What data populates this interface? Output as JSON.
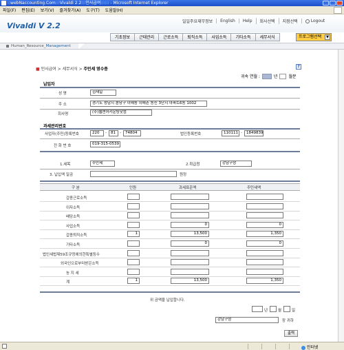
{
  "window": {
    "title": "::webNaccounting.Com:::Vivaldi 2.2:::인사급여:::::: - Microsoft Internet Explorer"
  },
  "menu": {
    "items": [
      "파일(F)",
      "편집(E)",
      "보기(V)",
      "즐겨찾기(A)",
      "도구(T)",
      "도움말(H)"
    ]
  },
  "app": {
    "logo": "Vivaldi  V 2.2",
    "top_links": [
      "일일주요재무정보",
      "English",
      "Help",
      "회사선택",
      "지점선택"
    ],
    "logout": "Logout",
    "nav_tabs": [
      "기초정보",
      "근태관리",
      "근로소득",
      "퇴직소득",
      "사업소득",
      "기타소득",
      "세무서식"
    ],
    "program_select": "프로그램선택",
    "module_label_prefix": "Human_Resource_",
    "module_label_accent": "Management"
  },
  "breadcrumb": {
    "root": "인사급여",
    "sep": ">",
    "mid": "세무서식",
    "current": "주민세 영수증"
  },
  "year_line": {
    "label": "귀속 연월 :",
    "year_unit": "년",
    "month_unit": "월분"
  },
  "payer": {
    "title": "납입자",
    "name_label": "성 명",
    "name_value": "김재일",
    "address_label": "주 소",
    "address_value": "경기도 성남시 분당구 이매동 이매촌 동신 3단지 아파트6동 1002",
    "company_label": "회사명",
    "company_value": "(주)웹앤어카운팅닷컴"
  },
  "tax_subject": {
    "title": "과세관리번호",
    "bizno_label": "사업자(주민)등록번호",
    "bizno_1": "220",
    "bizno_2": "81",
    "bizno_3": "74804",
    "corpno_label": "법인등록번호",
    "corpno_1": "110111",
    "corpno_2": "1849839",
    "phone_label": "전 화 번 호",
    "phone_value": "019-315-0539",
    "dash": "-"
  },
  "tax_info": {
    "item_label": "1.세목",
    "item_value": "주민세",
    "office_label": "2.취급청",
    "office_value": "강남구청",
    "due_label": "3. 납입액 일금",
    "due_unit": "원정"
  },
  "table": {
    "headers": [
      "구 분",
      "인원",
      "과세표준액",
      "주민세액"
    ],
    "rows": [
      {
        "label": "갑종근로소득",
        "count": "",
        "base": "",
        "tax": ""
      },
      {
        "label": "이자소득",
        "count": "",
        "base": "",
        "tax": ""
      },
      {
        "label": "배당소득",
        "count": "",
        "base": "",
        "tax": ""
      },
      {
        "label": "사업소득",
        "count": "",
        "base": "0",
        "tax": "0"
      },
      {
        "label": "갑종퇴직소득",
        "count": "1",
        "base": "13,500",
        "tax": "1,350"
      },
      {
        "label": "기타소득",
        "count": "",
        "base": "0",
        "tax": "0"
      },
      {
        "label": "법인세법제59조규정에의한특별징수",
        "count": "",
        "base": "",
        "tax": ""
      },
      {
        "label": "외국인으로부터받은소득",
        "count": "",
        "base": "",
        "tax": ""
      },
      {
        "label": "농 지 세",
        "count": "",
        "base": "",
        "tax": ""
      },
      {
        "label": "계",
        "count": "1",
        "base": "13,500",
        "tax": "1,350"
      }
    ]
  },
  "footer": {
    "statement": "위 금액을 납입합니다.",
    "year_unit": "년",
    "month_unit": "월",
    "day_unit": "일",
    "recipient_value": "강남구청",
    "recipient_suffix": "장 귀하",
    "print_label": "출력"
  },
  "statusbar": {
    "zone": "인터넷"
  },
  "colors": {
    "accent": "#1e5fa8",
    "title_bar": "#2a5fd6",
    "program_select": "#ffcc44",
    "year_box": "#aab8d6"
  }
}
